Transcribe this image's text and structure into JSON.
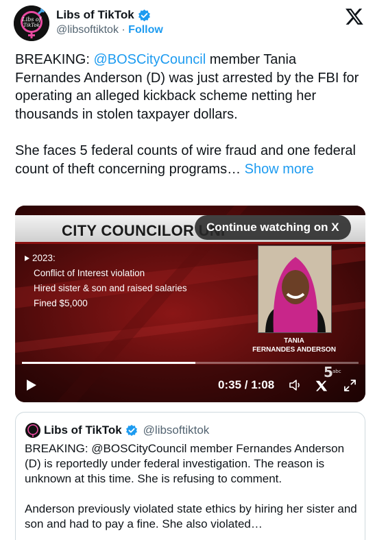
{
  "author": {
    "display_name": "Libs of TikTok",
    "handle": "@libsoftiktok",
    "separator": "·",
    "follow_label": "Follow",
    "avatar_text": [
      "Libs of",
      "TikTok"
    ]
  },
  "tweet": {
    "para1_prefix": "BREAKING: ",
    "para1_mention": "@BOSCityCouncil",
    "para1_rest": " member Tania Fernandes Anderson (D) was just arrested by the FBI for operating an alleged kickback scheme netting her thousands in stolen taxpayer dollars.",
    "para2": "She faces 5 federal counts of wire fraud and one federal count of theft concerning programs… ",
    "show_more": "Show more"
  },
  "video": {
    "banner_title": "CITY COUNCILOR UNI",
    "continue_label": "Continue watching on X",
    "bullet_year": "2023:",
    "lines": [
      "Conflict of Interest violation",
      "Hired sister & son and raised salaries",
      "Fined $5,000"
    ],
    "caption_line1": "TANIA",
    "caption_line2": "FERNANDES ANDERSON",
    "time": "0:35 / 1:08",
    "progress": 0.515,
    "station_label": "abc"
  },
  "quote": {
    "display_name": "Libs of TikTok",
    "handle": "@libsoftiktok",
    "para1": "BREAKING: @BOSCityCouncil member Fernandes Anderson (D) is reportedly under federal investigation. The reason is unknown at this time. She is refusing to comment.",
    "para2": "Anderson previously violated state ethics by hiring her sister and son and had to pay a fine. She also violated…"
  },
  "colors": {
    "link": "#1d9bf0",
    "verified": "#1d9bf0",
    "text": "#0f1419",
    "secondary": "#536471"
  }
}
